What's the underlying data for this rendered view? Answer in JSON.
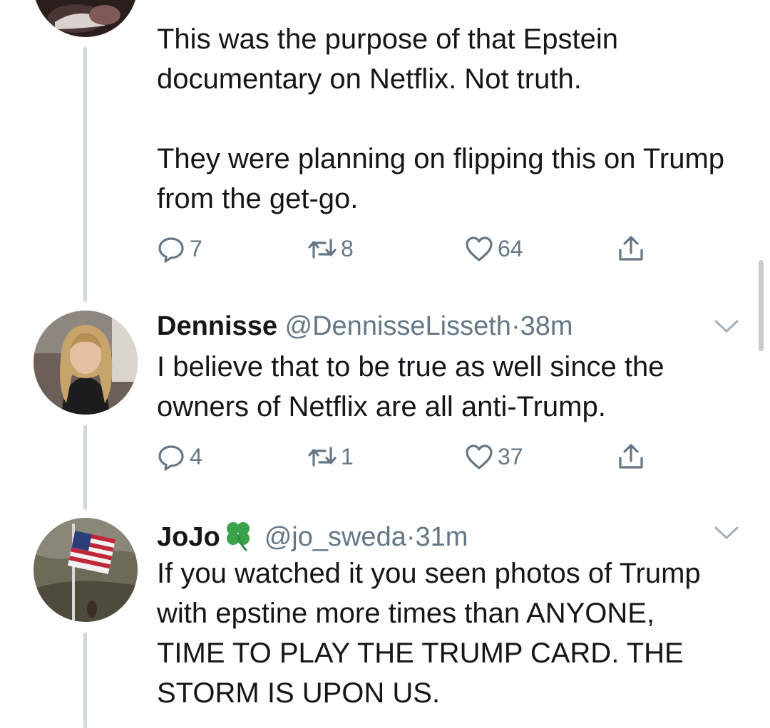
{
  "tweets": [
    {
      "text_paragraphs": [
        "This was the purpose of that Epstein documentary on Netflix. Not truth.",
        "They were planning on flipping this on Trump from the get-go."
      ],
      "actions": {
        "replies": "7",
        "retweets": "8",
        "likes": "64"
      }
    },
    {
      "name": "Dennisse",
      "handle": "@DennisseLisseth",
      "separator": "·",
      "time": "38m",
      "text": "I believe that to be true as well since the owners of Netflix are all anti-Trump.",
      "actions": {
        "replies": "4",
        "retweets": "1",
        "likes": "37"
      }
    },
    {
      "name": "JoJo",
      "name_emoji": "🍀",
      "handle": "@jo_sweda",
      "separator": "·",
      "time": "31m",
      "text": "If you watched it you seen photos of Trump with epstine more times than ANYONE, TIME TO PLAY THE TRUMP CARD. THE STORM IS UPON US."
    }
  ],
  "icons": {
    "reply": "reply-icon",
    "retweet": "retweet-icon",
    "like": "heart-icon",
    "share": "share-icon",
    "menu": "chevron-down-icon"
  },
  "colors": {
    "text": "#14171a",
    "secondary": "#657786",
    "thread_line": "#cfd9de",
    "clover": "#3aa34a"
  }
}
